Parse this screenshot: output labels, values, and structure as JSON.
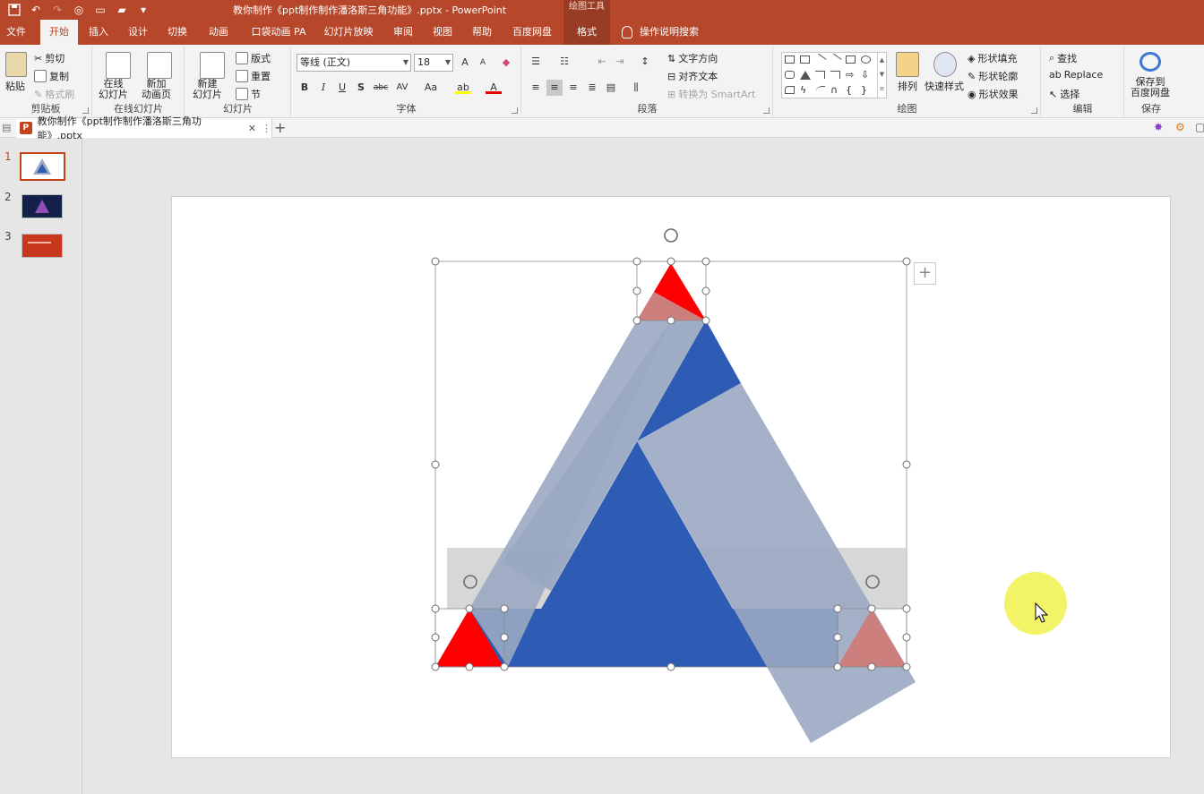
{
  "titlebar": {
    "title": "教你制作《ppt制作制作潘洛斯三角功能》.pptx  -  PowerPoint",
    "context_header": "绘图工具",
    "qat": [
      "save-icon",
      "undo-icon",
      "redo-icon",
      "slideshow-icon",
      "new-file-icon",
      "open-folder-icon",
      "customize-icon"
    ]
  },
  "tabs": {
    "file": "文件",
    "home": "开始",
    "insert": "插入",
    "design": "设计",
    "transitions": "切换",
    "animations": "动画",
    "pocket": "口袋动画 PA",
    "slideshow": "幻灯片放映",
    "review": "审阅",
    "view": "视图",
    "help": "帮助",
    "baidu": "百度网盘",
    "format": "格式",
    "tellme": "操作说明搜索"
  },
  "ribbon": {
    "clipboard": {
      "label": "剪贴板",
      "paste": "粘贴",
      "cut": "剪切",
      "copy": "复制",
      "format_painter": "格式刷"
    },
    "online": {
      "label": "在线幻灯片",
      "online_slides": "在线\n幻灯片",
      "add_anim": "新加\n动画页"
    },
    "slides": {
      "label": "幻灯片",
      "new_slide": "新建\n幻灯片",
      "layout": "版式",
      "reset": "重置",
      "section": "节"
    },
    "font": {
      "label": "字体",
      "font_name": "等线 (正文)",
      "font_size": "18",
      "bold": "B",
      "italic": "I",
      "underline": "U",
      "shadow": "S",
      "strike": "abc",
      "spacing": "AV",
      "case": "Aa",
      "grow": "A",
      "shrink": "A"
    },
    "paragraph": {
      "label": "段落",
      "text_direction": "文字方向",
      "align_text": "对齐文本",
      "smartart": "转换为 SmartArt"
    },
    "drawing": {
      "label": "绘图",
      "arrange": "排列",
      "quick_styles": "快速样式",
      "fill": "形状填充",
      "outline": "形状轮廓",
      "effects": "形状效果"
    },
    "editing": {
      "label": "编辑",
      "find": "查找",
      "replace": "Replace",
      "select": "选择"
    },
    "save": {
      "label": "保存",
      "save_baidu": "保存到\n百度网盘"
    }
  },
  "doc_tab": {
    "name": "教你制作《ppt制作制作潘洛斯三角功能》.pptx"
  },
  "thumbnails": [
    {
      "num": "1",
      "selected": true
    },
    {
      "num": "2",
      "selected": false
    },
    {
      "num": "3",
      "selected": false
    }
  ],
  "colors": {
    "accent": "#b7472a",
    "tri_blue": "#2e5bb3",
    "tri_gray_blue": "#9aa8c2",
    "red": "#ff0000",
    "pink": "#cd7f7d",
    "selection_gray": "#d0d0d0",
    "cursor_highlight": "#f0f03c"
  }
}
